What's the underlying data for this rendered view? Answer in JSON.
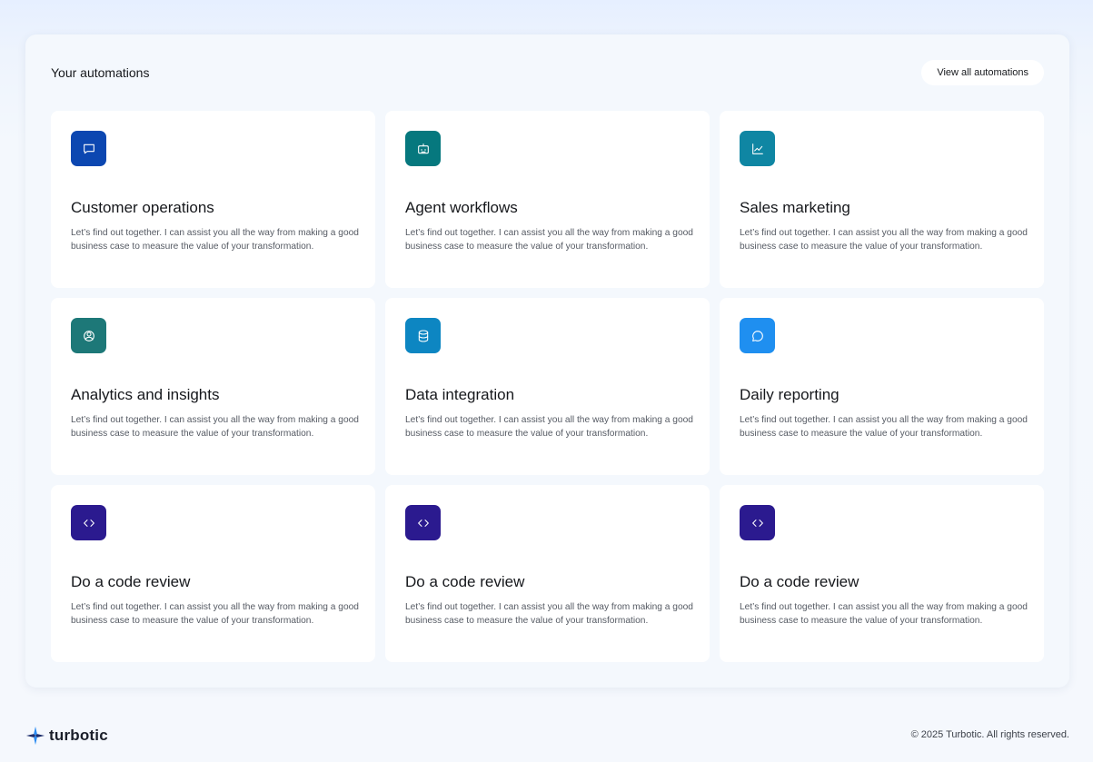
{
  "panel": {
    "title": "Your automations",
    "view_all_label": "View all automations"
  },
  "cards": [
    {
      "title": "Customer operations",
      "description": "Let’s find out together. I can assist you all the way from making a good business case to measure the value of your transformation.",
      "icon": "message-square-icon",
      "color": "#0c47b1"
    },
    {
      "title": "Agent workflows",
      "description": "Let’s find out together. I can assist you all the way from making a good business case to measure the value of your transformation.",
      "icon": "bot-icon",
      "color": "#06787e"
    },
    {
      "title": "Sales marketing",
      "description": "Let’s find out together. I can assist you all the way from making a good business case to measure the value of your transformation.",
      "icon": "trending-chart-icon",
      "color": "#0f86a3"
    },
    {
      "title": "Analytics and insights",
      "description": "Let’s find out together. I can assist you all the way from making a good business case to measure the value of your transformation.",
      "icon": "users-icon",
      "color": "#1d7878"
    },
    {
      "title": "Data integration",
      "description": "Let’s find out together. I can assist you all the way from making a good business case to measure the value of your transformation.",
      "icon": "database-icon",
      "color": "#0d86c2"
    },
    {
      "title": "Daily reporting",
      "description": "Let’s find out together. I can assist you all the way from making a good business case to measure the value of your transformation.",
      "icon": "message-circle-icon",
      "color": "#1f8ff0"
    },
    {
      "title": "Do a code review",
      "description": "Let’s find out together. I can assist you all the way from making a good business case to measure the value of your transformation.",
      "icon": "code-icon",
      "color": "#2b1a8f"
    },
    {
      "title": "Do a code review",
      "description": "Let’s find out together. I can assist you all the way from making a good business case to measure the value of your transformation.",
      "icon": "code-icon",
      "color": "#2b1a8f"
    },
    {
      "title": "Do a code review",
      "description": "Let’s find out together. I can assist you all the way from making a good business case to measure the value of your transformation.",
      "icon": "code-icon",
      "color": "#2b1a8f"
    }
  ],
  "footer": {
    "brand": "turbotic",
    "copyright": "© 2025 Turbotic. All rights reserved."
  },
  "colors": {
    "logo_blue": "#2a8bf2",
    "logo_dark": "#1b2c6b"
  }
}
